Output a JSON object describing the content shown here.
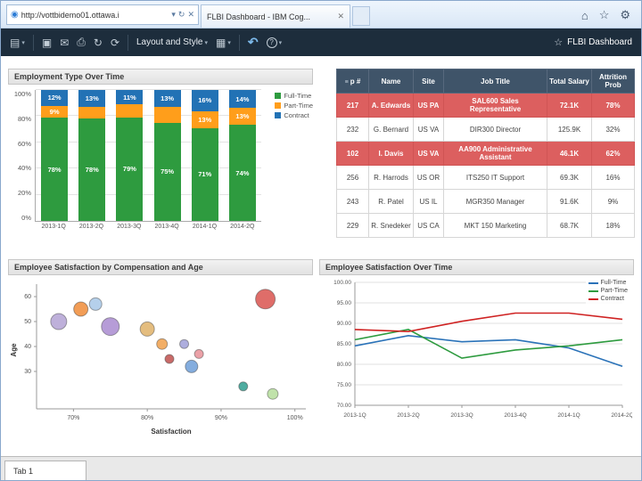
{
  "browser": {
    "url": "http://vottbidemo01.ottawa.i",
    "url_caret": "▾",
    "refresh_icon": "↻",
    "stop_icon": "✕",
    "favicon": "◉",
    "tab_title": "FLBI Dashboard - IBM Cog...",
    "tab_close": "✕",
    "actions": [
      {
        "name": "home",
        "glyph": "⌂"
      },
      {
        "name": "favorites",
        "glyph": "☆"
      },
      {
        "name": "settings",
        "glyph": "⚙"
      }
    ]
  },
  "toolbar": {
    "items": [
      {
        "name": "menu",
        "glyph": "▤",
        "caret": true
      },
      {
        "type": "sep"
      },
      {
        "name": "save",
        "glyph": "▣"
      },
      {
        "name": "email",
        "glyph": "✉"
      },
      {
        "name": "print",
        "glyph": "⎙"
      },
      {
        "name": "refresh",
        "glyph": "↻"
      },
      {
        "name": "reset",
        "glyph": "⟳"
      },
      {
        "type": "sep"
      },
      {
        "name": "layout-and-style",
        "label": "Layout and Style",
        "caret": true
      },
      {
        "name": "chart-type",
        "glyph": "▦",
        "caret": true
      },
      {
        "type": "sep"
      },
      {
        "name": "undo",
        "glyph": "↶",
        "accent": true
      },
      {
        "name": "help",
        "glyph": "?",
        "circle": true,
        "caret": true
      }
    ],
    "star": "☆",
    "dashboard_title": "FLBI Dashboard"
  },
  "table": {
    "columns": [
      "p #",
      "Name",
      "Site",
      "Job Title",
      "Total Salary",
      "Attrition Prob"
    ],
    "rows": [
      {
        "emp": "217",
        "name": "A. Edwards",
        "site": "US PA",
        "job": "SAL600 Sales Representative",
        "salary": "72.1K",
        "attrition": "78%",
        "highlight": true
      },
      {
        "emp": "232",
        "name": "G. Bernard",
        "site": "US VA",
        "job": "DIR300 Director",
        "salary": "125.9K",
        "attrition": "32%",
        "highlight": false
      },
      {
        "emp": "102",
        "name": "I. Davis",
        "site": "US VA",
        "job": "AA900 Administrative Assistant",
        "salary": "46.1K",
        "attrition": "62%",
        "highlight": true
      },
      {
        "emp": "256",
        "name": "R. Harrods",
        "site": "US OR",
        "job": "ITS250 IT Support",
        "salary": "69.3K",
        "attrition": "16%",
        "highlight": false
      },
      {
        "emp": "243",
        "name": "R. Patel",
        "site": "US IL",
        "job": "MGR350 Manager",
        "salary": "91.6K",
        "attrition": "9%",
        "highlight": false
      },
      {
        "emp": "229",
        "name": "R. Snedeker",
        "site": "US CA",
        "job": "MKT 150 Marketing",
        "salary": "68.7K",
        "attrition": "18%",
        "highlight": false
      }
    ]
  },
  "bottom_tab": "Tab 1",
  "chart_data": [
    {
      "id": "employment",
      "type": "bar",
      "stacked": true,
      "title": "Employment Type Over Time",
      "categories": [
        "2013-1Q",
        "2013-2Q",
        "2013-3Q",
        "2013-4Q",
        "2014-1Q",
        "2014-2Q"
      ],
      "series": [
        {
          "name": "Full-Time",
          "color": "#2e9b3f",
          "values": [
            78,
            78,
            79,
            75,
            71,
            74
          ],
          "labels": [
            "78%",
            "78%",
            "79%",
            "75%",
            "71%",
            "74%"
          ]
        },
        {
          "name": "Part-Time",
          "color": "#ff9e1b",
          "values": [
            9,
            9,
            10,
            12,
            13,
            13
          ],
          "labels": [
            "9%",
            "",
            "",
            "",
            "13%",
            "13%"
          ]
        },
        {
          "name": "Contract",
          "color": "#2272b5",
          "values": [
            12,
            13,
            11,
            13,
            16,
            14
          ],
          "labels": [
            "12%",
            "13%",
            "11%",
            "13%",
            "16%",
            "14%"
          ]
        }
      ],
      "yticks": [
        "100%",
        "80%",
        "60%",
        "40%",
        "20%",
        "0%"
      ],
      "ylim": [
        0,
        100
      ],
      "grid": true,
      "legend_position": "right"
    },
    {
      "id": "scatter",
      "type": "scatter",
      "title": "Employee Satisfaction by Compensation and Age",
      "xlabel": "Satisfaction",
      "ylabel": "Age",
      "xlim": [
        65,
        101
      ],
      "ylim": [
        15,
        65
      ],
      "xticks": [
        {
          "v": 70,
          "label": "70%"
        },
        {
          "v": 80,
          "label": "80%"
        },
        {
          "v": 90,
          "label": "90%"
        },
        {
          "v": 100,
          "label": "100%"
        }
      ],
      "yticks": [
        {
          "v": 60,
          "label": "60"
        },
        {
          "v": 50,
          "label": "50"
        },
        {
          "v": 40,
          "label": "40"
        },
        {
          "v": 30,
          "label": "30"
        }
      ],
      "grid": false,
      "points": [
        {
          "x": 68,
          "y": 50,
          "r": 9,
          "color": "#b3a2d4"
        },
        {
          "x": 71,
          "y": 55,
          "r": 8,
          "color": "#f08c38"
        },
        {
          "x": 73,
          "y": 57,
          "r": 7,
          "color": "#a8c8e8"
        },
        {
          "x": 75,
          "y": 48,
          "r": 10,
          "color": "#a98bd0"
        },
        {
          "x": 80,
          "y": 47,
          "r": 8,
          "color": "#dfb269"
        },
        {
          "x": 82,
          "y": 41,
          "r": 6,
          "color": "#f0a04b"
        },
        {
          "x": 83,
          "y": 35,
          "r": 5,
          "color": "#c0504d"
        },
        {
          "x": 85,
          "y": 41,
          "r": 5,
          "color": "#a0a0d8"
        },
        {
          "x": 86,
          "y": 32,
          "r": 7,
          "color": "#6f9fd8"
        },
        {
          "x": 87,
          "y": 37,
          "r": 5,
          "color": "#e89098"
        },
        {
          "x": 93,
          "y": 24,
          "r": 5,
          "color": "#2f9e8f"
        },
        {
          "x": 96,
          "y": 59,
          "r": 11,
          "color": "#d9534f"
        },
        {
          "x": 97,
          "y": 21,
          "r": 6,
          "color": "#b5dd9b"
        }
      ]
    },
    {
      "id": "satisfaction_over_time",
      "type": "line",
      "title": "Employee Satisfaction Over Time",
      "categories": [
        "2013-1Q",
        "2013-2Q",
        "2013-3Q",
        "2013-4Q",
        "2014-1Q",
        "2014-2Q"
      ],
      "ylim": [
        70,
        100
      ],
      "yticks": [
        "100.00",
        "95.00",
        "90.00",
        "85.00",
        "80.00",
        "75.00",
        "70.00"
      ],
      "grid": true,
      "legend_position": "top-right",
      "series": [
        {
          "name": "Full-Time",
          "color": "#2a72b8",
          "values": [
            84.5,
            87,
            85.5,
            86,
            84,
            79.5
          ]
        },
        {
          "name": "Part-Time",
          "color": "#2e9b3f",
          "values": [
            86,
            88.5,
            81.5,
            83.5,
            84.5,
            86
          ]
        },
        {
          "name": "Contract",
          "color": "#cf2222",
          "values": [
            88.5,
            88,
            90.5,
            92.5,
            92.5,
            91
          ]
        }
      ]
    }
  ]
}
